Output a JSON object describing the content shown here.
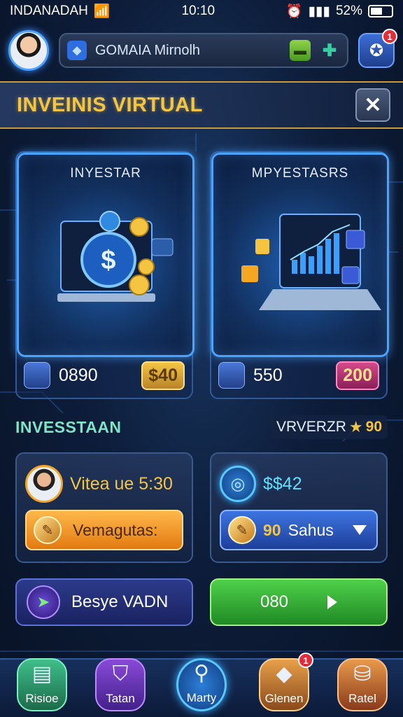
{
  "status_bar": {
    "carrier": "INDANADAH",
    "time": "10:10",
    "battery": "52%"
  },
  "header": {
    "player_name": "GOMAIA Mirnolh",
    "notification_count": "1"
  },
  "banner": {
    "title": "INVEINIS VIRTUAL"
  },
  "cards": [
    {
      "title": "INYESTAR",
      "value": "0890",
      "price": "$40",
      "icon": "coins-icon"
    },
    {
      "title": "MPYESTASRS",
      "value": "550",
      "price": "200",
      "icon": "cube-icon"
    }
  ],
  "section": {
    "title": "INVESSTAAN",
    "right_label": "VRVERZR",
    "right_value": "90"
  },
  "panels": {
    "left": {
      "text": "Vitea ue 5:30",
      "button_label": "Vemagutas:"
    },
    "right": {
      "value": "$$42",
      "select_label": "Sahus",
      "select_prefix": "90"
    }
  },
  "actions": {
    "left_label": "Besye VADN",
    "right_label": "080"
  },
  "nav": [
    {
      "label": "Risioe",
      "icon": "chart-icon"
    },
    {
      "label": "Tatan",
      "icon": "shield-icon"
    },
    {
      "label": "Marty",
      "icon": "search-icon"
    },
    {
      "label": "Glenen",
      "icon": "diamond-icon",
      "badge": "1"
    },
    {
      "label": "Ratel",
      "icon": "bag-icon"
    }
  ],
  "colors": {
    "accent_gold": "#f5c542",
    "accent_blue": "#4aa3ff",
    "accent_green": "#4fd04a",
    "accent_teal": "#7fe4c6"
  }
}
